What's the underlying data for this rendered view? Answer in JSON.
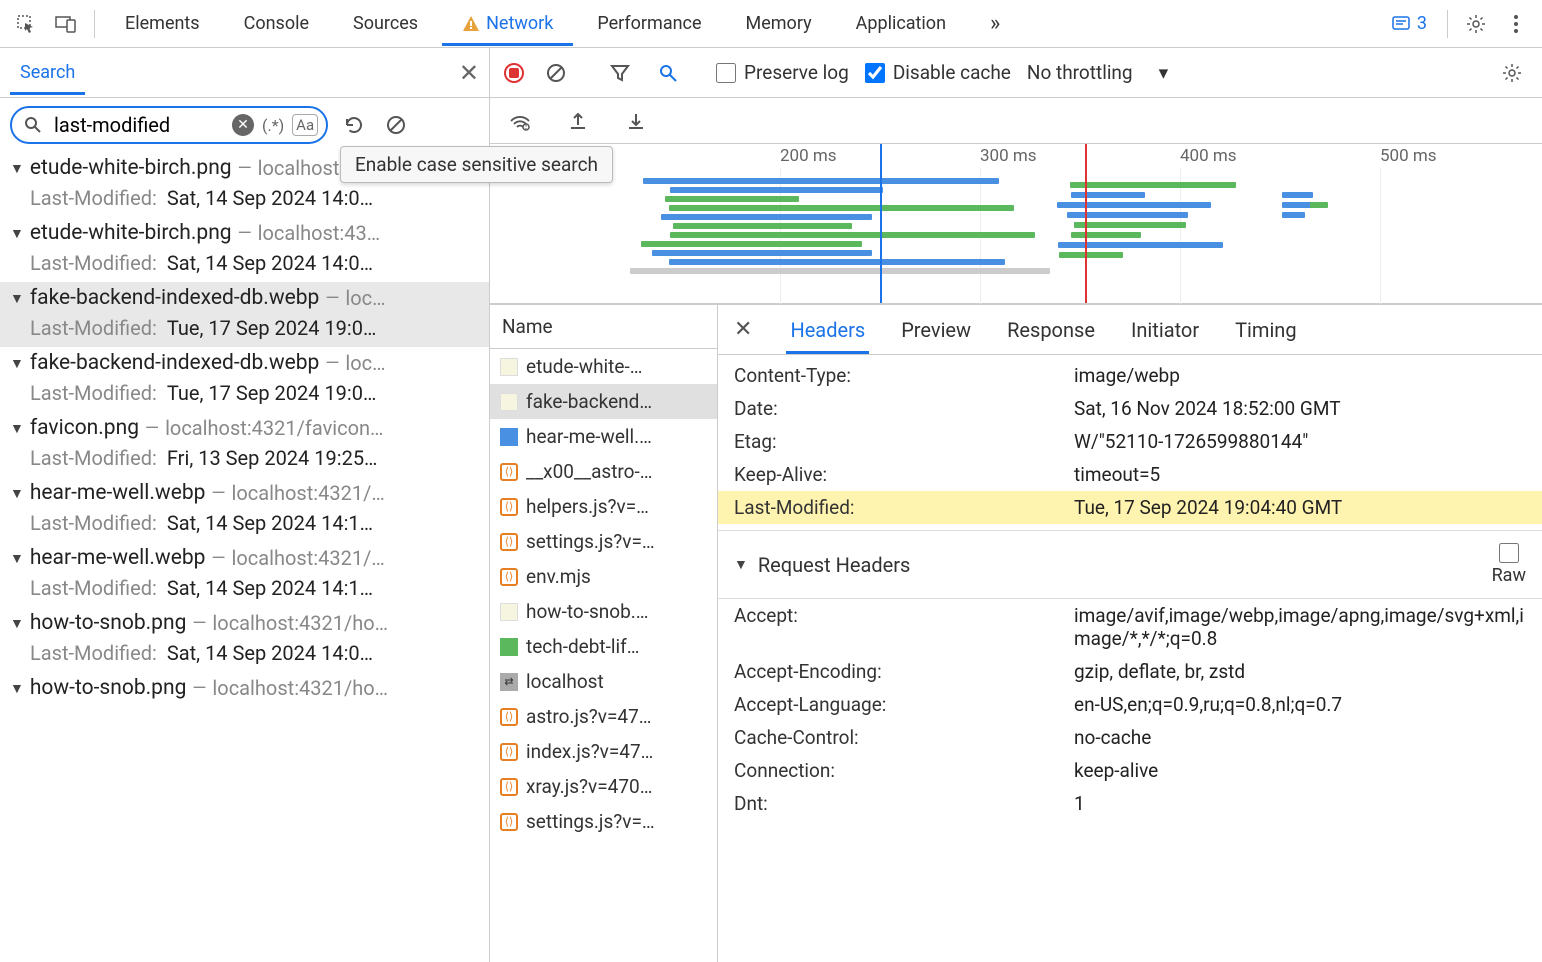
{
  "topTabs": {
    "elements": "Elements",
    "console": "Console",
    "sources": "Sources",
    "network": "Network",
    "performance": "Performance",
    "memory": "Memory",
    "application": "Application",
    "more": "»",
    "issuesCount": "3"
  },
  "search": {
    "tab": "Search",
    "value": "last-modified",
    "regex": "(.*)",
    "case": "Aa",
    "tooltip": "Enable case sensitive search"
  },
  "results": [
    {
      "file": "etude-white-birch.png",
      "loc": "localhost:43…",
      "key": "Last-Modified:",
      "val": "Sat, 14 Sep 2024 14:0…"
    },
    {
      "file": "etude-white-birch.png",
      "loc": "localhost:43…",
      "key": "Last-Modified:",
      "val": "Sat, 14 Sep 2024 14:0…"
    },
    {
      "file": "fake-backend-indexed-db.webp",
      "loc": "loc…",
      "key": "Last-Modified:",
      "val": "Tue, 17 Sep 2024 19:0…",
      "sel": true
    },
    {
      "file": "fake-backend-indexed-db.webp",
      "loc": "loc…",
      "key": "Last-Modified:",
      "val": "Tue, 17 Sep 2024 19:0…"
    },
    {
      "file": "favicon.png",
      "loc": "localhost:4321/favicon…",
      "key": "Last-Modified:",
      "val": "Fri, 13 Sep 2024 19:25…"
    },
    {
      "file": "hear-me-well.webp",
      "loc": "localhost:4321/…",
      "key": "Last-Modified:",
      "val": "Sat, 14 Sep 2024 14:1…"
    },
    {
      "file": "hear-me-well.webp",
      "loc": "localhost:4321/…",
      "key": "Last-Modified:",
      "val": "Sat, 14 Sep 2024 14:1…"
    },
    {
      "file": "how-to-snob.png",
      "loc": "localhost:4321/ho…",
      "key": "Last-Modified:",
      "val": "Sat, 14 Sep 2024 14:0…"
    },
    {
      "file": "how-to-snob.png",
      "loc": "localhost:4321/ho…",
      "key": "",
      "val": ""
    }
  ],
  "netToolbar": {
    "preserve": "Preserve log",
    "disableCache": "Disable cache",
    "throttling": "No throttling"
  },
  "timeline": {
    "ticks": [
      "200 ms",
      "300 ms",
      "400 ms",
      "500 ms"
    ]
  },
  "reqList": {
    "header": "Name",
    "items": [
      {
        "icon": "img",
        "label": "etude-white-…"
      },
      {
        "icon": "img",
        "label": "fake-backend…",
        "sel": true
      },
      {
        "icon": "blu",
        "label": "hear-me-well.…"
      },
      {
        "icon": "js",
        "label": "__x00__astro-…"
      },
      {
        "icon": "js",
        "label": "helpers.js?v=…"
      },
      {
        "icon": "js",
        "label": "settings.js?v=…"
      },
      {
        "icon": "js",
        "label": "env.mjs"
      },
      {
        "icon": "img",
        "label": "how-to-snob.…"
      },
      {
        "icon": "grn",
        "label": "tech-debt-lif…"
      },
      {
        "icon": "doc",
        "label": "localhost"
      },
      {
        "icon": "js",
        "label": "astro.js?v=47…"
      },
      {
        "icon": "js",
        "label": "index.js?v=47…"
      },
      {
        "icon": "js",
        "label": "xray.js?v=470…"
      },
      {
        "icon": "js",
        "label": "settings.js?v=…"
      }
    ]
  },
  "detailTabs": {
    "headers": "Headers",
    "preview": "Preview",
    "response": "Response",
    "initiator": "Initiator",
    "timing": "Timing"
  },
  "responseHeaders": [
    {
      "k": "Content-Type:",
      "v": "image/webp"
    },
    {
      "k": "Date:",
      "v": "Sat, 16 Nov 2024 18:52:00 GMT"
    },
    {
      "k": "Etag:",
      "v": "W/\"52110-1726599880144\""
    },
    {
      "k": "Keep-Alive:",
      "v": "timeout=5"
    },
    {
      "k": "Last-Modified:",
      "v": "Tue, 17 Sep 2024 19:04:40 GMT",
      "hl": true
    }
  ],
  "requestSection": {
    "title": "Request Headers",
    "raw": "Raw"
  },
  "requestHeaders": [
    {
      "k": "Accept:",
      "v": "image/avif,image/webp,image/apng,image/svg+xml,image/*,*/*;q=0.8"
    },
    {
      "k": "Accept-Encoding:",
      "v": "gzip, deflate, br, zstd"
    },
    {
      "k": "Accept-Language:",
      "v": "en-US,en;q=0.9,ru;q=0.8,nl;q=0.7"
    },
    {
      "k": "Cache-Control:",
      "v": "no-cache"
    },
    {
      "k": "Connection:",
      "v": "keep-alive"
    },
    {
      "k": "Dnt:",
      "v": "1"
    }
  ]
}
